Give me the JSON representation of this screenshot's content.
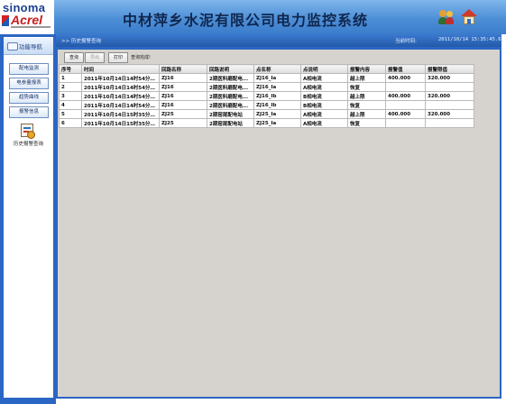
{
  "header": {
    "logo_top": "sinoma",
    "logo_brand": "Acrel",
    "title": "中材萍乡水泥有限公司电力监控系统",
    "users_icon": "users-icon",
    "home_icon": "home-icon",
    "bar_color": "#4d8fd6"
  },
  "sidebar": {
    "nav_title": "功能导航",
    "items": [
      {
        "label": "配电监测"
      },
      {
        "label": "电参量报表"
      },
      {
        "label": "趋势曲线"
      },
      {
        "label": "报警信息"
      }
    ],
    "history": {
      "label": "历史报警查询",
      "icon": "alarm-history-icon"
    }
  },
  "subheader": {
    "breadcrumb": ">> 历史报警查询",
    "time_label": "当前时间:",
    "time_value": "2011/10/14 15:35:45.6"
  },
  "toolbar": {
    "query": "查询",
    "export": "导出",
    "print": "打印",
    "status": "查询完成!"
  },
  "table": {
    "columns": [
      "序号",
      "时间",
      "回路名称",
      "回路说明",
      "点名称",
      "点说明",
      "报警内容",
      "报警值",
      "报警限值"
    ],
    "rows": [
      [
        "1",
        "2011年10月14日14时54分1...",
        "ZJ16",
        "2期医料磨配电...",
        "ZJ16_Ia",
        "A相电流",
        "越上限",
        "400.000",
        "320.000"
      ],
      [
        "2",
        "2011年10月14日14时54分1...",
        "ZJ16",
        "2期医料磨配电...",
        "ZJ16_Ia",
        "A相电流",
        "恢复",
        "",
        ""
      ],
      [
        "3",
        "2011年10月14日14时54分3...",
        "ZJ16",
        "2期医料磨配电...",
        "ZJ16_Ib",
        "B相电流",
        "越上限",
        "400.000",
        "320.000"
      ],
      [
        "4",
        "2011年10月14日14时54分3...",
        "ZJ16",
        "2期医料磨配电...",
        "ZJ16_Ib",
        "B相电流",
        "恢复",
        "",
        ""
      ],
      [
        "5",
        "2011年10月14日15时35分7...",
        "ZJ25",
        "2期窑尾配电站",
        "ZJ25_Ia",
        "A相电流",
        "越上限",
        "400.000",
        "320.000"
      ],
      [
        "6",
        "2011年10月14日15时35分7...",
        "ZJ25",
        "2期窑尾配电站",
        "ZJ25_Ia",
        "A相电流",
        "恢复",
        "",
        ""
      ]
    ]
  }
}
